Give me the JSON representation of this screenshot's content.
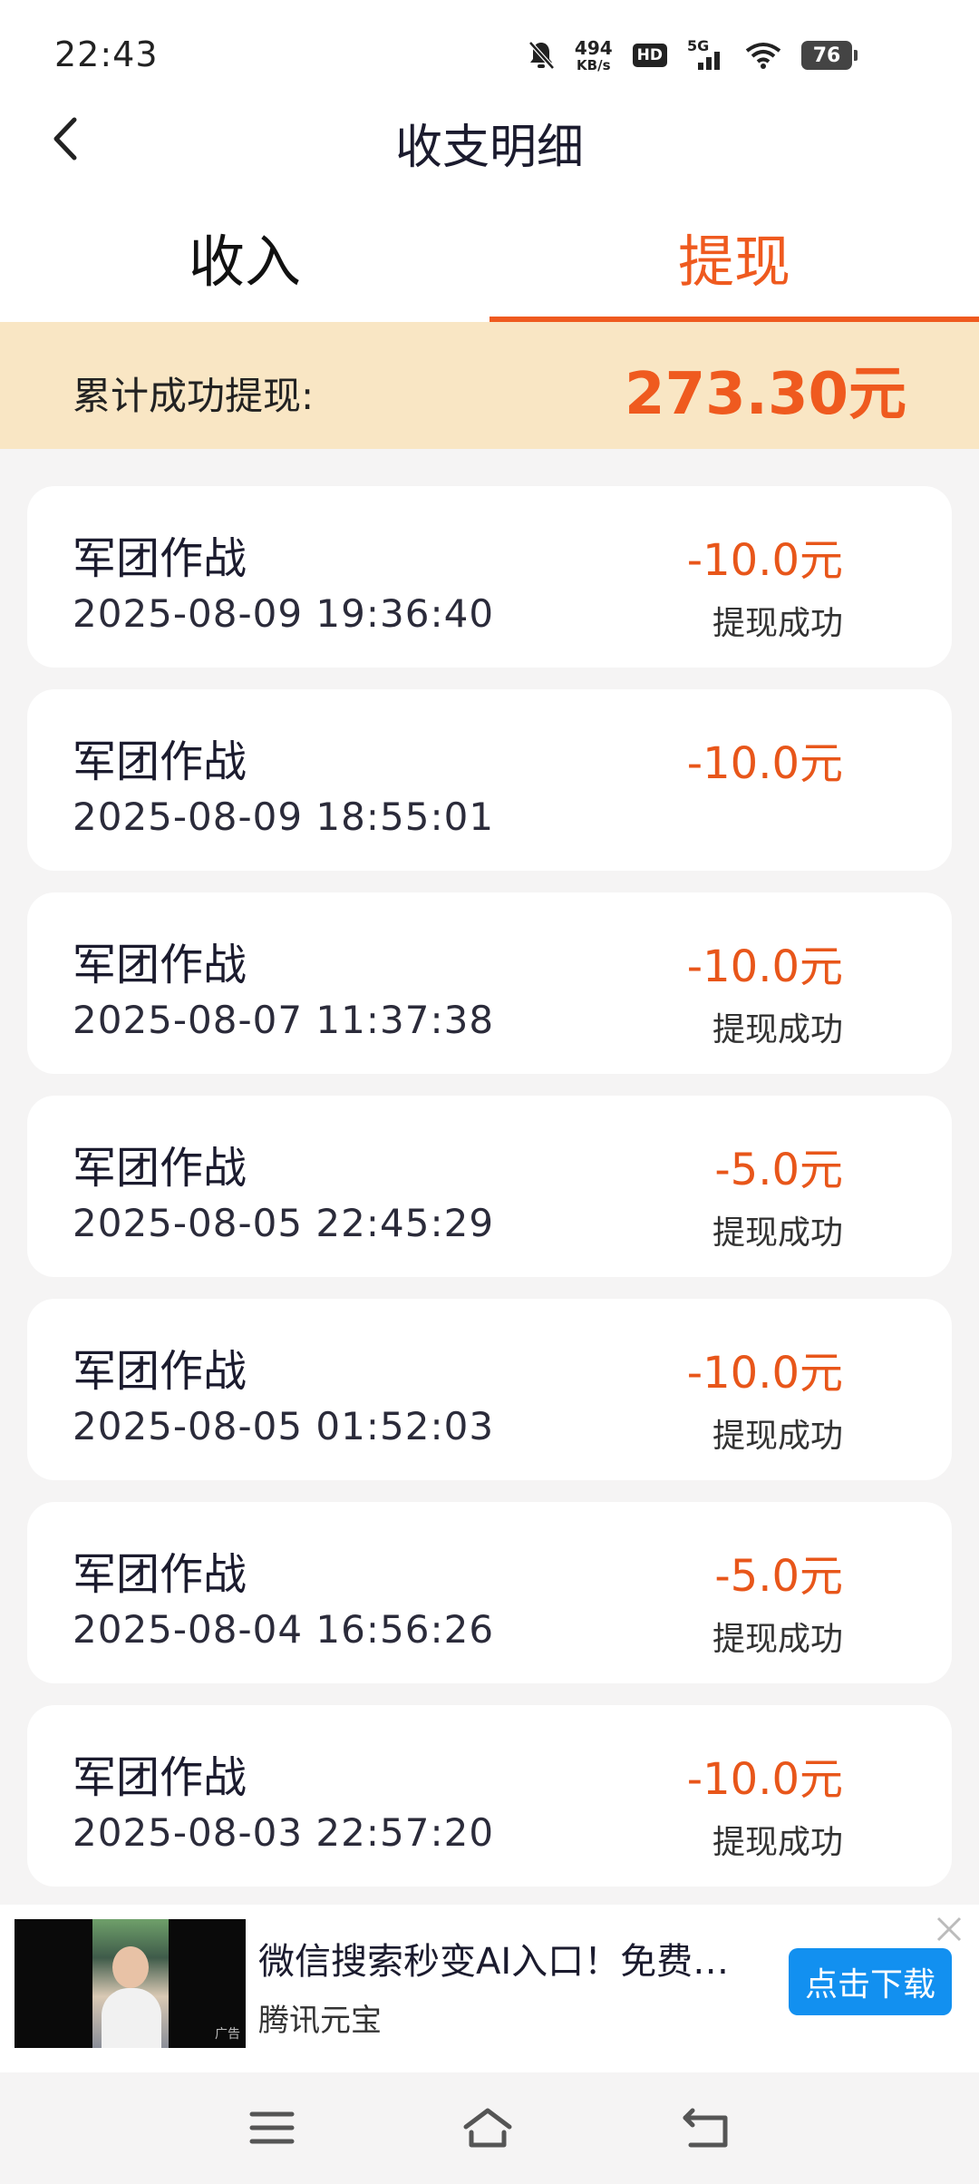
{
  "status_bar": {
    "time": "22:43",
    "net_speed_value": "494",
    "net_speed_unit": "KB/s",
    "hd_label": "HD",
    "network_label": "5G",
    "battery_level": "76"
  },
  "header": {
    "title": "收支明细"
  },
  "tabs": [
    {
      "label": "收入",
      "active": false
    },
    {
      "label": "提现",
      "active": true
    }
  ],
  "summary": {
    "label": "累计成功提现:",
    "value": "273.30元"
  },
  "records": [
    {
      "title": "军团作战",
      "time": "2025-08-09 19:36:40",
      "amount": "-10.0元",
      "status": "提现成功"
    },
    {
      "title": "军团作战",
      "time": "2025-08-09 18:55:01",
      "amount": "-10.0元",
      "status": ""
    },
    {
      "title": "军团作战",
      "time": "2025-08-07 11:37:38",
      "amount": "-10.0元",
      "status": "提现成功"
    },
    {
      "title": "军团作战",
      "time": "2025-08-05 22:45:29",
      "amount": "-5.0元",
      "status": "提现成功"
    },
    {
      "title": "军团作战",
      "time": "2025-08-05 01:52:03",
      "amount": "-10.0元",
      "status": "提现成功"
    },
    {
      "title": "军团作战",
      "time": "2025-08-04 16:56:26",
      "amount": "-5.0元",
      "status": "提现成功"
    },
    {
      "title": "军团作战",
      "time": "2025-08-03 22:57:20",
      "amount": "-10.0元",
      "status": "提现成功"
    }
  ],
  "ad": {
    "title": "微信搜索秒变AI入口！免费…",
    "source": "腾讯元宝",
    "button_label": "点击下载",
    "thumb_tag": "广告"
  },
  "colors": {
    "accent": "#ef5a1f",
    "summary_bg": "#f9e6c4",
    "ad_button": "#1290f0"
  },
  "icons": {
    "back": "chevron-left-icon",
    "ad_close": "close-icon",
    "nav_menu": "menu-icon",
    "nav_home": "home-icon",
    "nav_back": "return-icon"
  }
}
